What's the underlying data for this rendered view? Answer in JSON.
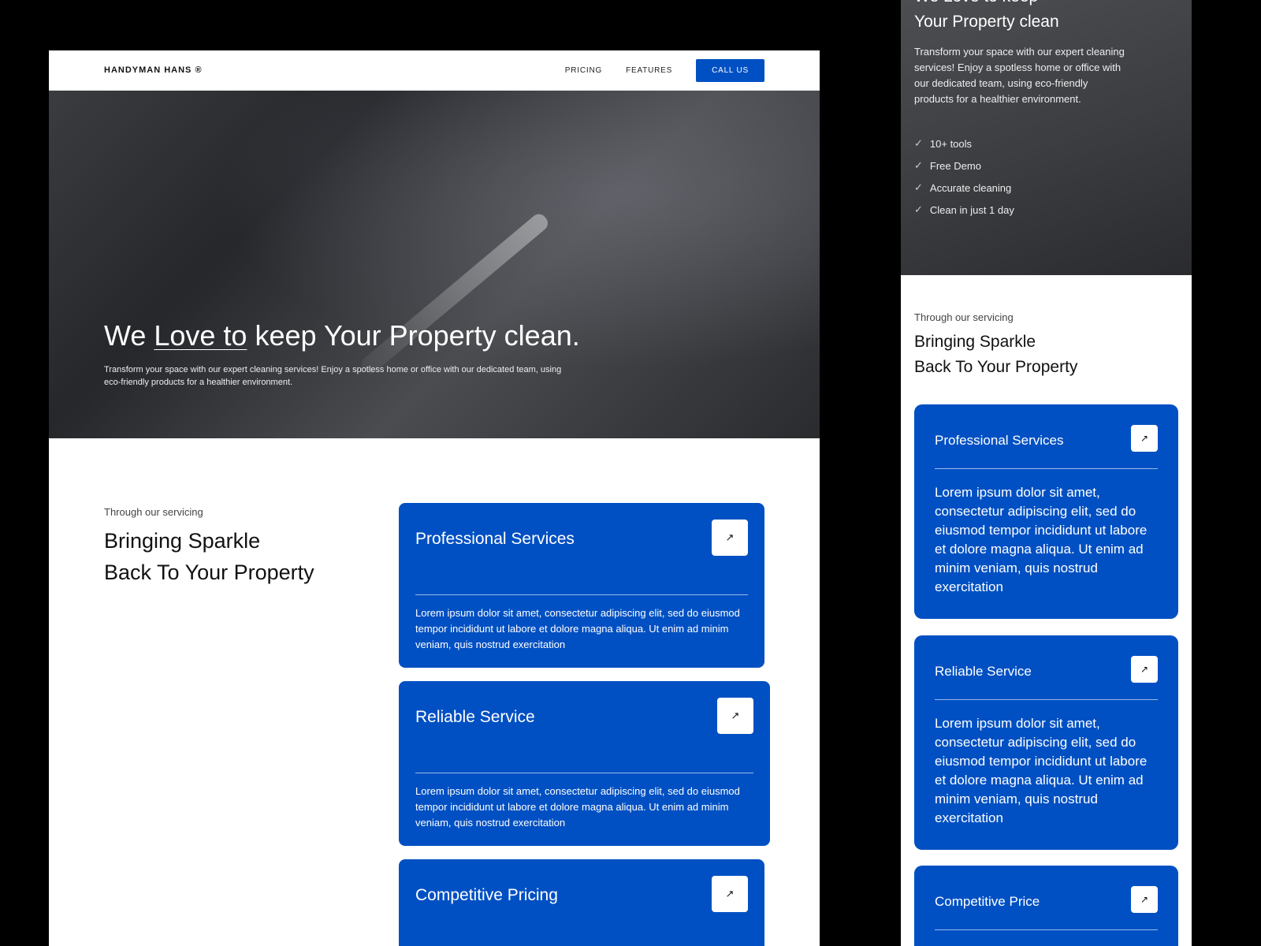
{
  "desktop": {
    "brand": "HANDYMAN HANS ®",
    "nav": {
      "pricing": "PRICING",
      "features": "FEATURES",
      "call": "CALL US"
    },
    "hero": {
      "title_pre": "We ",
      "title_link": "Love to",
      "title_post": " keep Your Property clean.",
      "text": "Transform your space with our expert cleaning services! Enjoy a spotless home or office with our dedicated team, using eco-friendly products for a healthier environment."
    },
    "section": {
      "subtitle": "Through our servicing",
      "title_1": "Bringing Sparkle",
      "title_2": "Back To Your Property"
    },
    "cards": [
      {
        "title": "Professional Services",
        "text": "Lorem ipsum dolor sit amet, consectetur adipiscing elit, sed do eiusmod tempor incididunt ut labore et dolore magna aliqua. Ut enim ad minim veniam, quis nostrud exercitation"
      },
      {
        "title": "Reliable Service",
        "text": "Lorem ipsum dolor sit amet, consectetur adipiscing elit, sed do eiusmod tempor incididunt ut labore et dolore magna aliqua. Ut enim ad minim veniam, quis nostrud exercitation"
      },
      {
        "title": "Competitive Pricing"
      }
    ]
  },
  "mobile": {
    "hero": {
      "title_1": "We Love to keep",
      "title_2": "Your Property clean",
      "text": "Transform your space with our expert cleaning services! Enjoy a spotless home or office with our dedicated team, using eco-friendly products for a healthier environment.",
      "checks": [
        "10+ tools",
        "Free Demo",
        "Accurate cleaning",
        "Clean in just 1 day"
      ]
    },
    "section": {
      "subtitle": "Through our servicing",
      "title_1": "Bringing Sparkle",
      "title_2": "Back To Your Property"
    },
    "cards": [
      {
        "title": "Professional Services",
        "text": "Lorem ipsum dolor sit amet, consectetur adipiscing elit, sed do eiusmod tempor incididunt ut labore et dolore magna aliqua. Ut enim ad minim veniam, quis nostrud exercitation"
      },
      {
        "title": "Reliable Service",
        "text": "Lorem ipsum dolor sit amet, consectetur adipiscing elit, sed do eiusmod tempor incididunt ut labore et dolore magna aliqua. Ut enim ad minim veniam, quis nostrud exercitation"
      },
      {
        "title": "Competitive Price"
      }
    ]
  },
  "icons": {
    "arrow": "↗",
    "check": "✓"
  },
  "colors": {
    "accent": "#0050c3"
  }
}
